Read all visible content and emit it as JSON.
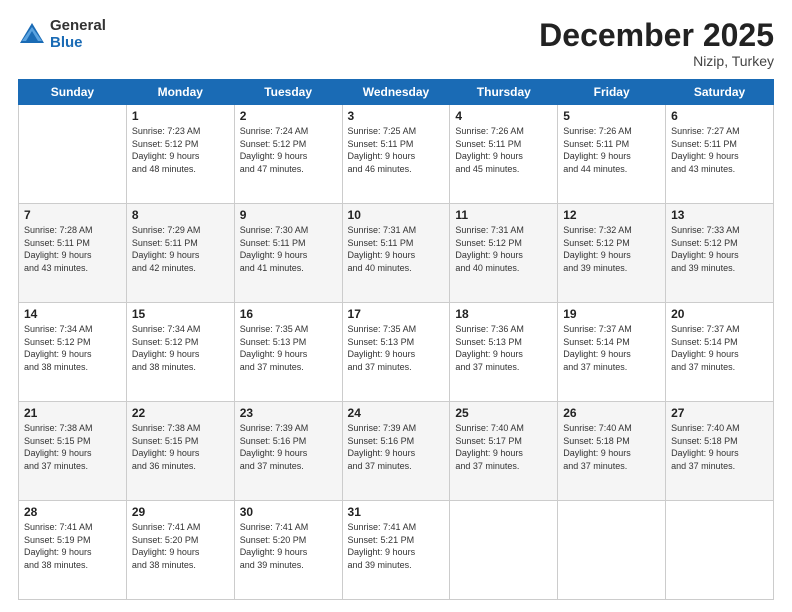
{
  "header": {
    "logo_general": "General",
    "logo_blue": "Blue",
    "title": "December 2025",
    "location": "Nizip, Turkey"
  },
  "days_of_week": [
    "Sunday",
    "Monday",
    "Tuesday",
    "Wednesday",
    "Thursday",
    "Friday",
    "Saturday"
  ],
  "weeks": [
    [
      {
        "day": "",
        "info": ""
      },
      {
        "day": "1",
        "info": "Sunrise: 7:23 AM\nSunset: 5:12 PM\nDaylight: 9 hours\nand 48 minutes."
      },
      {
        "day": "2",
        "info": "Sunrise: 7:24 AM\nSunset: 5:12 PM\nDaylight: 9 hours\nand 47 minutes."
      },
      {
        "day": "3",
        "info": "Sunrise: 7:25 AM\nSunset: 5:11 PM\nDaylight: 9 hours\nand 46 minutes."
      },
      {
        "day": "4",
        "info": "Sunrise: 7:26 AM\nSunset: 5:11 PM\nDaylight: 9 hours\nand 45 minutes."
      },
      {
        "day": "5",
        "info": "Sunrise: 7:26 AM\nSunset: 5:11 PM\nDaylight: 9 hours\nand 44 minutes."
      },
      {
        "day": "6",
        "info": "Sunrise: 7:27 AM\nSunset: 5:11 PM\nDaylight: 9 hours\nand 43 minutes."
      }
    ],
    [
      {
        "day": "7",
        "info": "Sunrise: 7:28 AM\nSunset: 5:11 PM\nDaylight: 9 hours\nand 43 minutes."
      },
      {
        "day": "8",
        "info": "Sunrise: 7:29 AM\nSunset: 5:11 PM\nDaylight: 9 hours\nand 42 minutes."
      },
      {
        "day": "9",
        "info": "Sunrise: 7:30 AM\nSunset: 5:11 PM\nDaylight: 9 hours\nand 41 minutes."
      },
      {
        "day": "10",
        "info": "Sunrise: 7:31 AM\nSunset: 5:11 PM\nDaylight: 9 hours\nand 40 minutes."
      },
      {
        "day": "11",
        "info": "Sunrise: 7:31 AM\nSunset: 5:12 PM\nDaylight: 9 hours\nand 40 minutes."
      },
      {
        "day": "12",
        "info": "Sunrise: 7:32 AM\nSunset: 5:12 PM\nDaylight: 9 hours\nand 39 minutes."
      },
      {
        "day": "13",
        "info": "Sunrise: 7:33 AM\nSunset: 5:12 PM\nDaylight: 9 hours\nand 39 minutes."
      }
    ],
    [
      {
        "day": "14",
        "info": "Sunrise: 7:34 AM\nSunset: 5:12 PM\nDaylight: 9 hours\nand 38 minutes."
      },
      {
        "day": "15",
        "info": "Sunrise: 7:34 AM\nSunset: 5:12 PM\nDaylight: 9 hours\nand 38 minutes."
      },
      {
        "day": "16",
        "info": "Sunrise: 7:35 AM\nSunset: 5:13 PM\nDaylight: 9 hours\nand 37 minutes."
      },
      {
        "day": "17",
        "info": "Sunrise: 7:35 AM\nSunset: 5:13 PM\nDaylight: 9 hours\nand 37 minutes."
      },
      {
        "day": "18",
        "info": "Sunrise: 7:36 AM\nSunset: 5:13 PM\nDaylight: 9 hours\nand 37 minutes."
      },
      {
        "day": "19",
        "info": "Sunrise: 7:37 AM\nSunset: 5:14 PM\nDaylight: 9 hours\nand 37 minutes."
      },
      {
        "day": "20",
        "info": "Sunrise: 7:37 AM\nSunset: 5:14 PM\nDaylight: 9 hours\nand 37 minutes."
      }
    ],
    [
      {
        "day": "21",
        "info": "Sunrise: 7:38 AM\nSunset: 5:15 PM\nDaylight: 9 hours\nand 37 minutes."
      },
      {
        "day": "22",
        "info": "Sunrise: 7:38 AM\nSunset: 5:15 PM\nDaylight: 9 hours\nand 36 minutes."
      },
      {
        "day": "23",
        "info": "Sunrise: 7:39 AM\nSunset: 5:16 PM\nDaylight: 9 hours\nand 37 minutes."
      },
      {
        "day": "24",
        "info": "Sunrise: 7:39 AM\nSunset: 5:16 PM\nDaylight: 9 hours\nand 37 minutes."
      },
      {
        "day": "25",
        "info": "Sunrise: 7:40 AM\nSunset: 5:17 PM\nDaylight: 9 hours\nand 37 minutes."
      },
      {
        "day": "26",
        "info": "Sunrise: 7:40 AM\nSunset: 5:18 PM\nDaylight: 9 hours\nand 37 minutes."
      },
      {
        "day": "27",
        "info": "Sunrise: 7:40 AM\nSunset: 5:18 PM\nDaylight: 9 hours\nand 37 minutes."
      }
    ],
    [
      {
        "day": "28",
        "info": "Sunrise: 7:41 AM\nSunset: 5:19 PM\nDaylight: 9 hours\nand 38 minutes."
      },
      {
        "day": "29",
        "info": "Sunrise: 7:41 AM\nSunset: 5:20 PM\nDaylight: 9 hours\nand 38 minutes."
      },
      {
        "day": "30",
        "info": "Sunrise: 7:41 AM\nSunset: 5:20 PM\nDaylight: 9 hours\nand 39 minutes."
      },
      {
        "day": "31",
        "info": "Sunrise: 7:41 AM\nSunset: 5:21 PM\nDaylight: 9 hours\nand 39 minutes."
      },
      {
        "day": "",
        "info": ""
      },
      {
        "day": "",
        "info": ""
      },
      {
        "day": "",
        "info": ""
      }
    ]
  ]
}
